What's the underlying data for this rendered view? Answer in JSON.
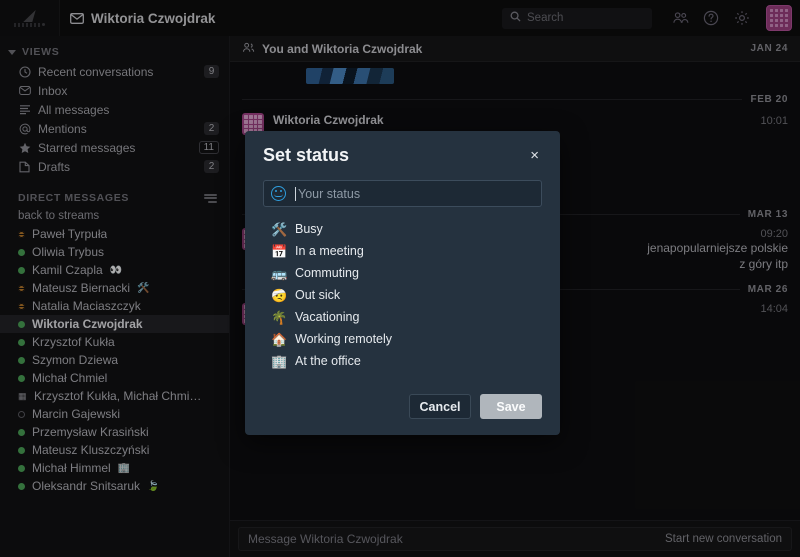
{
  "topbar": {
    "logo_name": "zulip-logo",
    "conversation_title": "Wiktoria Czwojdrak",
    "search_placeholder": "Search",
    "icons": [
      {
        "name": "users-icon"
      },
      {
        "name": "help-circle-icon"
      },
      {
        "name": "gear-icon"
      },
      {
        "name": "app-grid-icon"
      }
    ]
  },
  "sidebar": {
    "views_header": "VIEWS",
    "views": [
      {
        "icon": "clock-icon",
        "label": "Recent conversations",
        "badge": "9",
        "badge_style": "solid"
      },
      {
        "icon": "inbox-icon",
        "label": "Inbox",
        "badge": "",
        "badge_style": "none"
      },
      {
        "icon": "list-icon",
        "label": "All messages",
        "badge": "",
        "badge_style": "none"
      },
      {
        "icon": "at-icon",
        "label": "Mentions",
        "badge": "2",
        "badge_style": "solid"
      },
      {
        "icon": "star-icon",
        "label": "Starred messages",
        "badge": "11",
        "badge_style": "outline"
      },
      {
        "icon": "draft-icon",
        "label": "Drafts",
        "badge": "2",
        "badge_style": "solid"
      }
    ],
    "dm_header": "DIRECT MESSAGES",
    "dm_filter_icon": "filter-icon",
    "back_to_streams": "back to streams",
    "dms": [
      {
        "name": "Paweł Tyrpuła",
        "presence": "idle",
        "emoji": ""
      },
      {
        "name": "Oliwia Trybus",
        "presence": "active",
        "emoji": ""
      },
      {
        "name": "Kamil Czapla",
        "presence": "active",
        "emoji": "👀"
      },
      {
        "name": "Mateusz Biernacki",
        "presence": "idle",
        "emoji": "🛠️"
      },
      {
        "name": "Natalia Maciaszczyk",
        "presence": "idle",
        "emoji": ""
      },
      {
        "name": "Wiktoria Czwojdrak",
        "presence": "active",
        "emoji": "",
        "selected": true
      },
      {
        "name": "Krzysztof Kukła",
        "presence": "active",
        "emoji": ""
      },
      {
        "name": "Szymon Dziewa",
        "presence": "active",
        "emoji": ""
      },
      {
        "name": "Michał Chmiel",
        "presence": "active",
        "emoji": ""
      },
      {
        "name": "Krzysztof Kukła, Michał Chmi…",
        "presence": "group",
        "emoji": ""
      },
      {
        "name": "Marcin Gajewski",
        "presence": "offline",
        "emoji": ""
      },
      {
        "name": "Przemysław Krasiński",
        "presence": "active",
        "emoji": ""
      },
      {
        "name": "Mateusz Kluszczyński",
        "presence": "active",
        "emoji": ""
      },
      {
        "name": "Michał Himmel",
        "presence": "active",
        "emoji": "🏢"
      },
      {
        "name": "Oleksandr Snitsaruk",
        "presence": "active",
        "emoji": "🍃"
      }
    ]
  },
  "conversation": {
    "header_icon": "people-icon",
    "header_title": "You and Wiktoria Czwojdrak",
    "header_date": "JAN 24",
    "dividers": {
      "feb": "FEB 20",
      "mar13": "MAR 13",
      "mar26": "MAR 26"
    },
    "messages": [
      {
        "sender": "Wiktoria Czwojdrak",
        "time": "10:01",
        "text": ""
      },
      {
        "sender": "",
        "time": "09:20",
        "text": "jenapopularniejsze polskie"
      },
      {
        "sender": "",
        "time": "",
        "text": "z góry itp"
      },
      {
        "sender": "",
        "time": "14:04",
        "text": ""
      }
    ]
  },
  "compose": {
    "placeholder": "Message Wiktoria Czwojdrak",
    "start_new": "Start new conversation"
  },
  "modal": {
    "title": "Set status",
    "close_label": "×",
    "emoji_picker_icon": "smiley-icon",
    "input_placeholder": "Your status",
    "input_value": "",
    "options": [
      {
        "emoji": "🛠️",
        "label": "Busy"
      },
      {
        "emoji": "📅",
        "label": "In a meeting"
      },
      {
        "emoji": "🚌",
        "label": "Commuting"
      },
      {
        "emoji": "🤕",
        "label": "Out sick"
      },
      {
        "emoji": "🌴",
        "label": "Vacationing"
      },
      {
        "emoji": "🏠",
        "label": "Working remotely"
      },
      {
        "emoji": "🏢",
        "label": "At the office"
      }
    ],
    "cancel_label": "Cancel",
    "save_label": "Save"
  },
  "colors": {
    "modal_bg": "#25332f",
    "accent_pink": "#a8458c",
    "presence_active": "#4ba357",
    "presence_idle": "#b97a2c"
  }
}
